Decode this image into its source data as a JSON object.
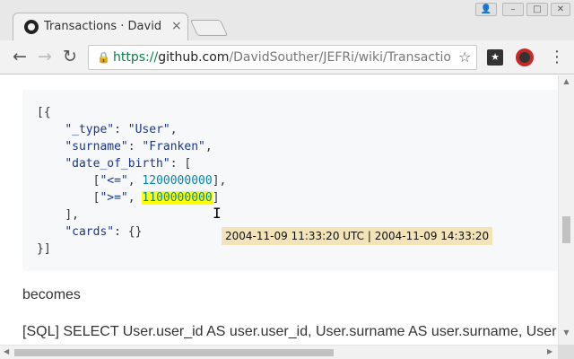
{
  "tab": {
    "title": "Transactions · David",
    "close": "×"
  },
  "window_controls": {
    "user": "👤",
    "minimize": "–",
    "maximize": "□",
    "close": "✕"
  },
  "toolbar": {
    "back": "←",
    "forward": "→",
    "reload": "↻",
    "url_scheme": "https://",
    "url_host": "github.com",
    "url_path": "/DavidSouther/JEFRi/wiki/Transactio",
    "star": "☆",
    "menu": "⋮"
  },
  "code": {
    "l1": "[{",
    "l2_key": "\"_type\"",
    "l2_val": "\"User\"",
    "l3_key": "\"surname\"",
    "l3_val": "\"Franken\"",
    "l4_key": "\"date_of_birth\"",
    "l5_op": "\"<=\"",
    "l5_num": "1200000000",
    "l6_op": "\">=\"",
    "l6_num": "1100000000",
    "l7": "],",
    "l8_key": "\"cards\"",
    "l8_val": "{}",
    "l9": "}]"
  },
  "tooltip": "2004-11-09 11:33:20 UTC | 2004-11-09 14:33:20",
  "paragraph": "becomes",
  "sql": "[SQL] SELECT User.user_id AS user.user_id, User.surname AS user.surname, User",
  "icons": {
    "favicon": "github-icon",
    "lock": "lock-icon",
    "ext1": "bookmark-extension-icon",
    "ext2": "extension-icon"
  }
}
